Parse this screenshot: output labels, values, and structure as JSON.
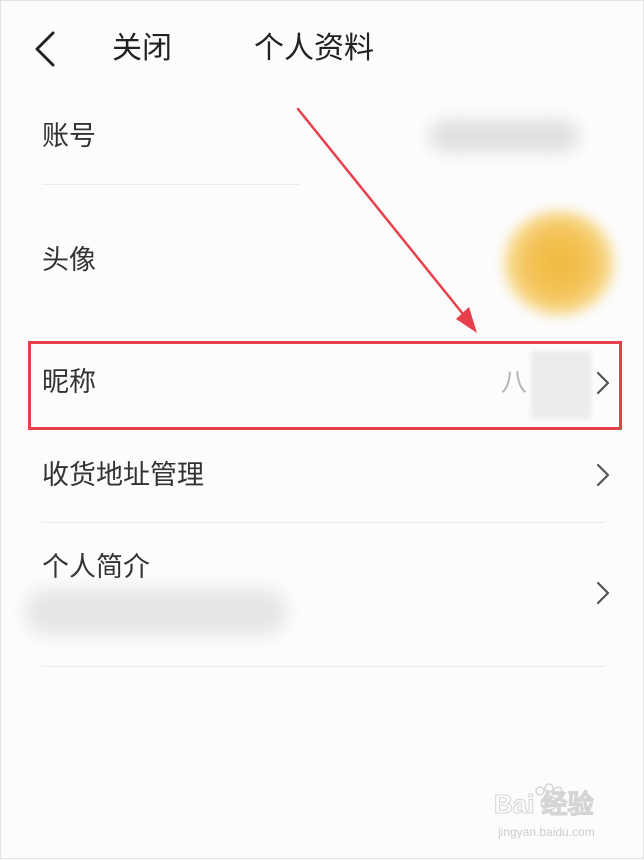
{
  "header": {
    "close_label": "关闭",
    "title": "个人资料",
    "back_icon": "chevron-left-icon"
  },
  "profile": {
    "account_label": "账号",
    "avatar_label": "头像",
    "nickname_label": "昵称",
    "nickname_value": "八",
    "address_label": "收货地址管理",
    "bio_label": "个人简介"
  },
  "annotation": {
    "highlight_color": "#e8404a",
    "arrow_color": "#e8404a"
  },
  "watermark": {
    "brand": "Bai 经验",
    "url": "jingyan.baidu.com"
  },
  "colors": {
    "background": "#fcfcfc",
    "text": "#333333",
    "muted": "#b5b5b5",
    "divider": "#ececec"
  }
}
